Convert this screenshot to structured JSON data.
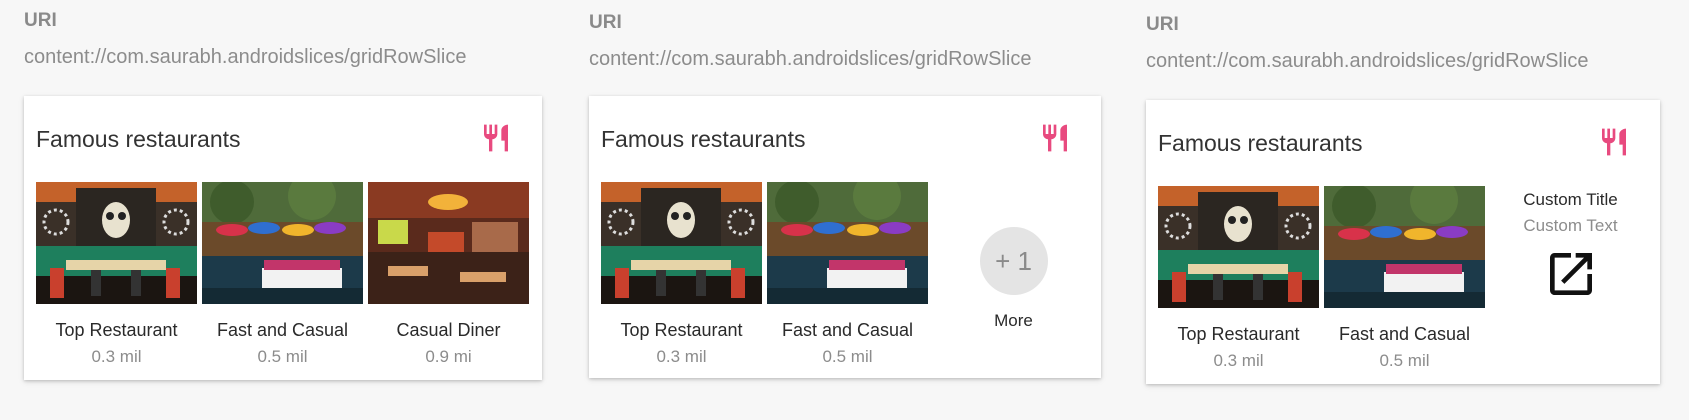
{
  "colors": {
    "accent": "#e84a7f",
    "background": "#f7f7f7",
    "card": "#ffffff"
  },
  "panels": [
    {
      "uri_label": "URI",
      "uri_value": "content://com.saurabh.androidslices/gridRowSlice",
      "card_title": "Famous restaurants",
      "header_icon": "restaurant-icon",
      "items": [
        {
          "title": "Top Restaurant",
          "subtitle": "0.3 mil"
        },
        {
          "title": "Fast and Casual",
          "subtitle": "0.5 mil"
        },
        {
          "title": "Casual Diner",
          "subtitle": "0.9 mi"
        }
      ]
    },
    {
      "uri_label": "URI",
      "uri_value": "content://com.saurabh.androidslices/gridRowSlice",
      "card_title": "Famous restaurants",
      "header_icon": "restaurant-icon",
      "items": [
        {
          "title": "Top Restaurant",
          "subtitle": "0.3 mil"
        },
        {
          "title": "Fast and Casual",
          "subtitle": "0.5 mil"
        }
      ],
      "more": {
        "count": "+ 1",
        "label": "More"
      }
    },
    {
      "uri_label": "URI",
      "uri_value": "content://com.saurabh.androidslices/gridRowSlice",
      "card_title": "Famous restaurants",
      "header_icon": "restaurant-icon",
      "items": [
        {
          "title": "Top Restaurant",
          "subtitle": "0.3 mil"
        },
        {
          "title": "Fast and Casual",
          "subtitle": "0.5 mil"
        }
      ],
      "custom": {
        "title": "Custom Title",
        "text": "Custom Text",
        "icon": "open-in-new-icon"
      }
    }
  ]
}
